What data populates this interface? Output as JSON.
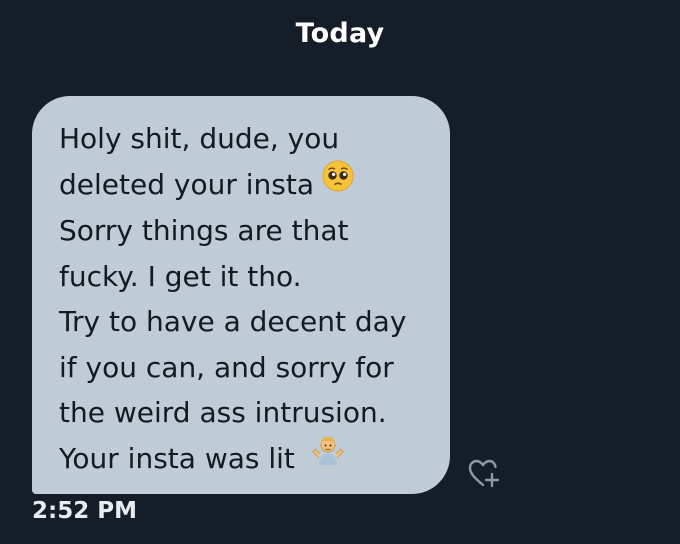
{
  "header": {
    "date_label": "Today"
  },
  "message": {
    "lines": [
      "Holy shit, dude, you",
      "deleted your insta",
      "Sorry things are that",
      "fucky. I get it tho.",
      "Try to have a decent day",
      "if you can, and sorry for",
      "the weird ass intrusion.",
      "Your insta was lit"
    ],
    "emojis": [
      "pleading-face-icon",
      "person-shrugging-icon"
    ],
    "timestamp": "2:52 PM",
    "bubble_color": "#bfcbd6"
  },
  "actions": {
    "react_icon": "heart-plus-icon"
  },
  "theme": {
    "background": "#151d28",
    "text_on_bubble": "#141a22"
  }
}
